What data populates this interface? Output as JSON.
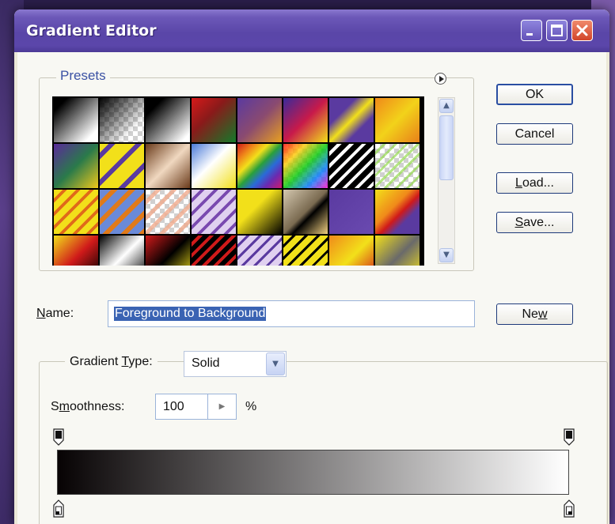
{
  "window": {
    "title": "Gradient Editor"
  },
  "presets": {
    "label": "Presets"
  },
  "buttons": {
    "ok": "OK",
    "cancel": "Cancel",
    "load_pre": "",
    "load_ul": "L",
    "load_post": "oad...",
    "save_pre": "",
    "save_ul": "S",
    "save_post": "ave...",
    "new_pre": "Ne",
    "new_ul": "w",
    "new_post": ""
  },
  "name": {
    "label_pre": "",
    "label_ul": "N",
    "label_post": "ame:",
    "value": "Foreground to Background"
  },
  "gradient_type": {
    "label_pre": "Gradient ",
    "label_ul": "T",
    "label_post": "ype:",
    "value": "Solid"
  },
  "smoothness": {
    "label_pre": "S",
    "label_ul": "m",
    "label_post": "oothness:",
    "value": "100",
    "unit": "%"
  },
  "gradient_bar": {
    "start_color": "#070304",
    "end_color": "#ffffff"
  },
  "colors": {
    "titlebar": "#5a46a8",
    "button_border": "#1e3a7a",
    "selection": "#3a63b3"
  }
}
